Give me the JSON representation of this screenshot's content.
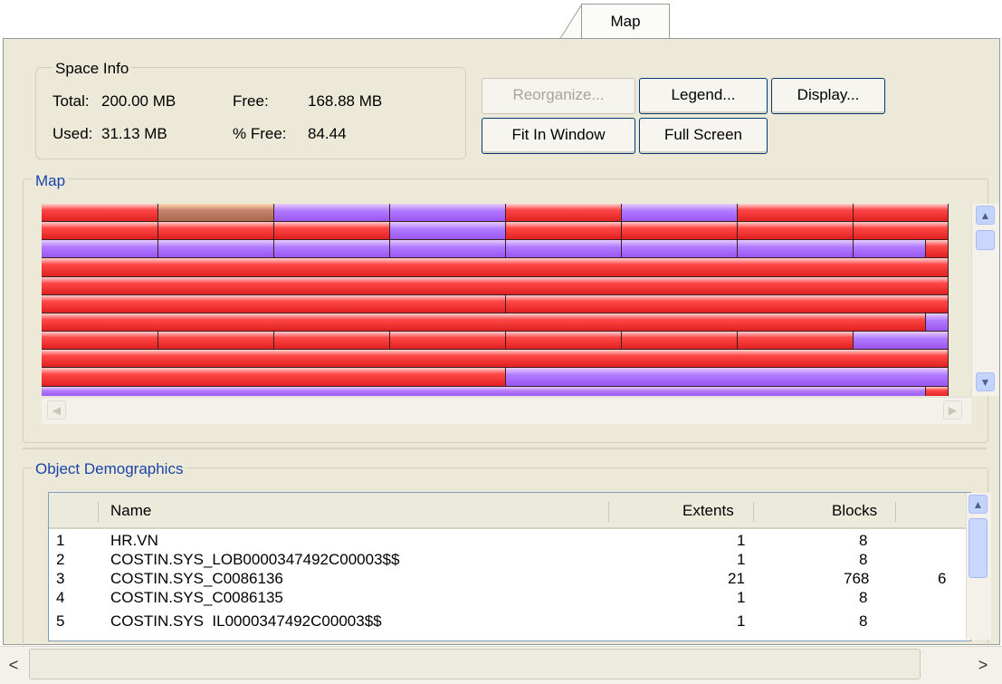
{
  "tab": {
    "label": "Map"
  },
  "space_info": {
    "title": "Space Info",
    "total_label": "Total:",
    "total_value": "200.00 MB",
    "free_label": "Free:",
    "free_value": "168.88 MB",
    "used_label": "Used:",
    "used_value": "31.13 MB",
    "pct_free_label": "% Free:",
    "pct_free_value": "84.44"
  },
  "buttons": {
    "reorganize": "Reorganize...",
    "legend": "Legend...",
    "display": "Display...",
    "fit_in_window": "Fit In Window",
    "full_screen": "Full Screen"
  },
  "map": {
    "title": "Map"
  },
  "demographics": {
    "title": "Object Demographics",
    "columns": [
      "Name",
      "Extents",
      "Blocks"
    ],
    "rows": [
      {
        "num": "1",
        "name": "HR.VN",
        "extents": "1",
        "blocks": "8",
        "extra": ""
      },
      {
        "num": "2",
        "name": "COSTIN.SYS_LOB0000347492C00003$$",
        "extents": "1",
        "blocks": "8",
        "extra": ""
      },
      {
        "num": "3",
        "name": "COSTIN.SYS_C0086136",
        "extents": "21",
        "blocks": "768",
        "extra": "6"
      },
      {
        "num": "4",
        "name": "COSTIN.SYS_C0086135",
        "extents": "1",
        "blocks": "8",
        "extra": ""
      },
      {
        "num": "5",
        "name": "COSTIN.SYS_IL0000347492C00003$$",
        "extents": "1",
        "blocks": "8",
        "extra": ""
      }
    ]
  },
  "colors": {
    "used_red": "#e02020",
    "used_purple": "#9a55f0",
    "used_orange": "#a86a50"
  }
}
